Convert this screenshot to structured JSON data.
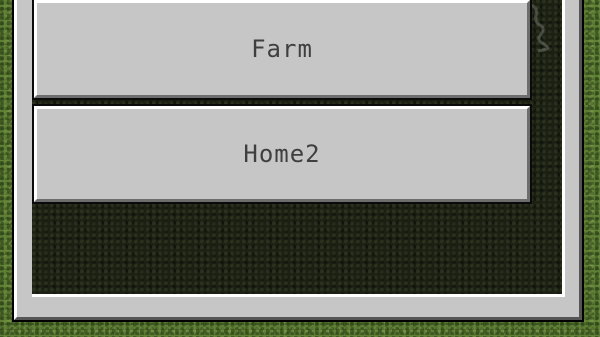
{
  "waypoint_list": {
    "entries": [
      {
        "label": "Farm"
      },
      {
        "label": "Home2"
      }
    ]
  },
  "colors": {
    "button_face": "#c6c6c6",
    "button_text": "#3f3f3f",
    "list_background": "#1b2012",
    "grass": "#5f7f35"
  }
}
